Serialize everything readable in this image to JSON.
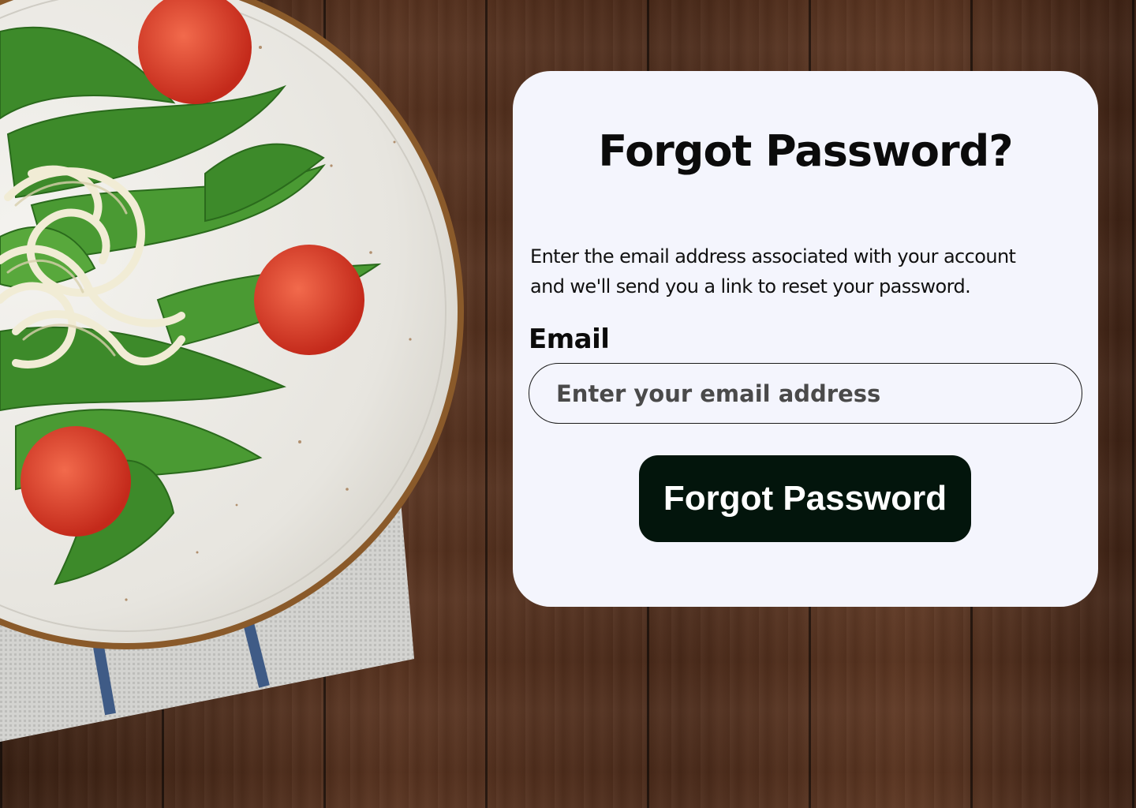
{
  "form": {
    "title": "Forgot Password?",
    "description": "Enter the email address associated with your account and we'll send you a link to reset your password.",
    "email_label": "Email",
    "email_placeholder": "Enter your email address",
    "email_value": "",
    "submit_label": "Forgot Password"
  },
  "colors": {
    "card_background": "#f4f5fd",
    "button_background": "#03150c",
    "button_text": "#ffffff",
    "text": "#0b0b0b"
  },
  "background": {
    "image_subject": "salad-plate-on-wooden-table"
  }
}
